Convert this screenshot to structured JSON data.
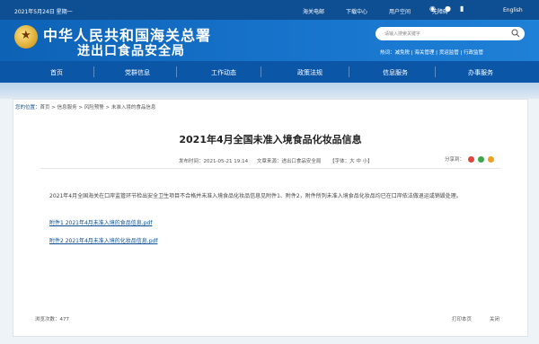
{
  "topbar": {
    "date": "2021年5月24日 星期一",
    "links": [
      "海关电邮",
      "下载中心",
      "用户空间",
      "无障碍"
    ],
    "lang": "English"
  },
  "header": {
    "title_line1": "中华人民共和国海关总署",
    "title_line2": "进出口食品安全局",
    "search_placeholder": "请输入搜索关键字",
    "hot_links": "热词：减免税 | 海关管理 | 货运监管 | 行政监管"
  },
  "nav": {
    "items": [
      "首页",
      "党群信息",
      "工作动态",
      "政策法规",
      "信息服务",
      "办事服务"
    ]
  },
  "breadcrumb": {
    "label": "您的位置：",
    "path": "首页 > 信息服务 > 风险预警 > 未准入境的食品信息"
  },
  "article": {
    "title": "2021年4月全国未准入境食品化妆品信息",
    "publish_time": "发布时间：2021-05-21 19:14",
    "source": "文章来源：进出口食品安全局",
    "font_size": "【字体：大 中 小】",
    "share_label": "分享到：",
    "body": "2021年4月全国海关在口岸监管环节检出安全卫生项目不合格并未准入境食品化妆品信息见附件1、附件2，附件所列未准入境食品化妆品均已在口岸依法做退运或销毁处理。",
    "attachments": [
      "附件1 2021年4月未准入境的食品信息.pdf",
      "附件2 2021年4月未准入境的化妆品信息.pdf"
    ],
    "views": "浏览次数：477",
    "print": "打印本页",
    "close": "关闭"
  },
  "colors": {
    "brand_blue": "#0e4f93",
    "header_blue": "#1875cd",
    "nav_blue": "#0c56a8"
  }
}
